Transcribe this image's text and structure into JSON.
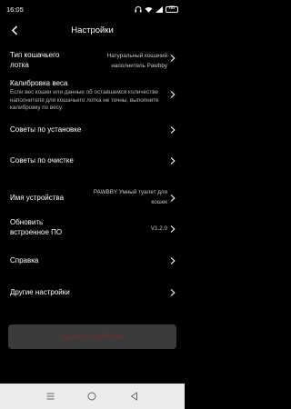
{
  "status": {
    "time": "16:05",
    "battery": "88"
  },
  "header": {
    "title": "Настройки"
  },
  "rows": {
    "litter": {
      "label": "Тип кошачьего лотка",
      "value": "Натуральный кошачий наполнитель Pawbby"
    },
    "calibration": {
      "label": "Калибровка веса",
      "desc": "Если вес кошки или данные об оставшемся количестве наполнителя для кошачьего лотка не точны, выполните калибровку по весу."
    },
    "install_tips": {
      "label": "Советы по установке"
    },
    "cleaning_tips": {
      "label": "Советы по очистке"
    },
    "device_name": {
      "label": "Имя устройства",
      "value": "PAWBBY Умный туалет для кошек"
    },
    "firmware": {
      "label": "Обновить встроенное ПО",
      "value": "V1.2.0"
    },
    "help": {
      "label": "Справка"
    },
    "other": {
      "label": "Другие настройки"
    }
  },
  "delete_button": {
    "label": "Удалить устройство"
  },
  "colors": {
    "background": "#000000",
    "button_bg": "#3b3b3b",
    "danger_text": "#7a2c2c",
    "navbar_bg": "#ececec"
  },
  "icons": [
    "back-icon",
    "chevron-right-icon",
    "menu-icon",
    "home-icon",
    "triangle-back-icon"
  ]
}
